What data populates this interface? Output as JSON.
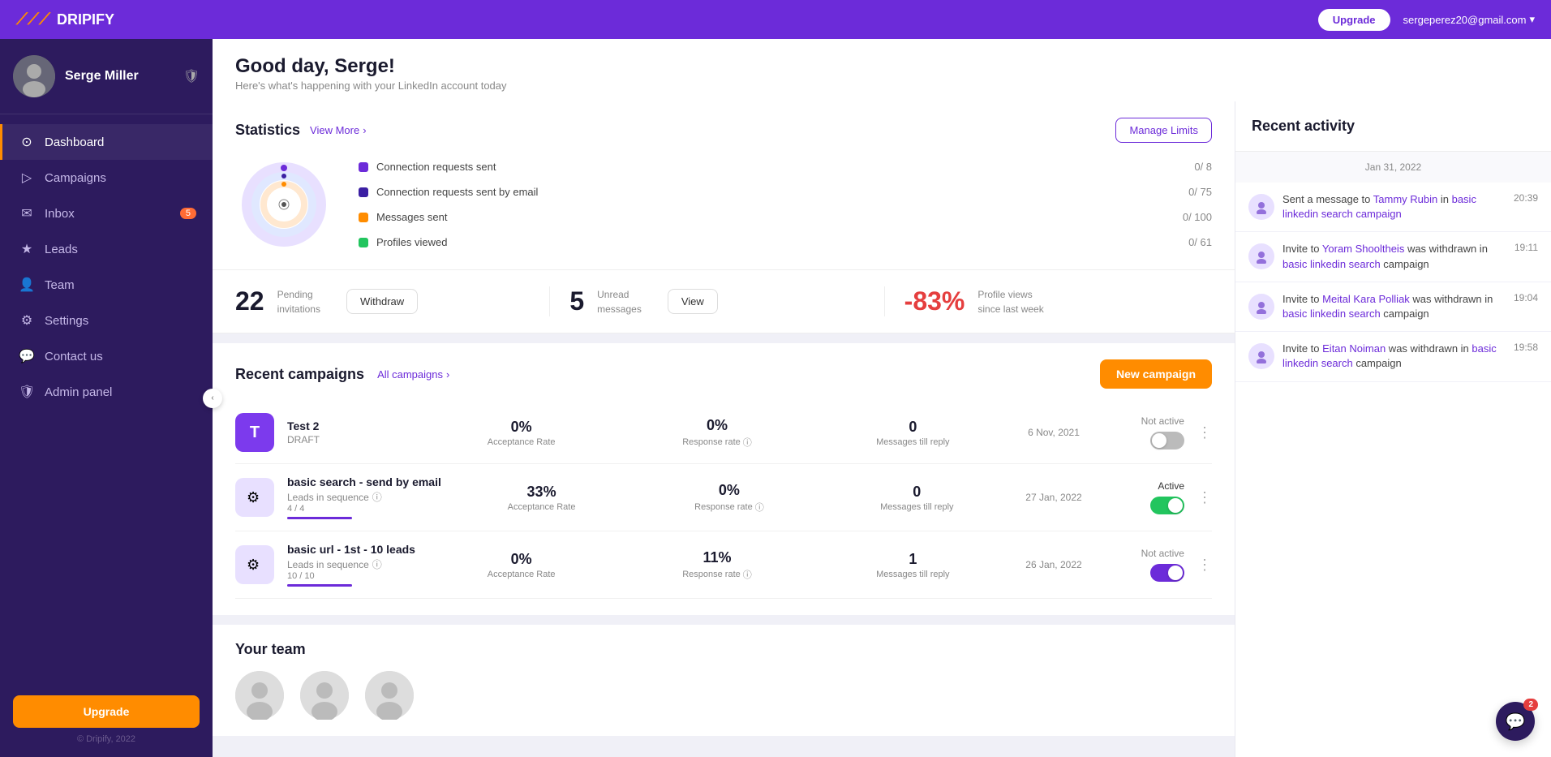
{
  "topbar": {
    "logo_text": "DRIPIFY",
    "upgrade_btn": "Upgrade",
    "user_email": "sergeperez20@gmail.com"
  },
  "sidebar": {
    "user_name": "Serge Miller",
    "nav_items": [
      {
        "id": "dashboard",
        "label": "Dashboard",
        "icon": "⊙",
        "active": true
      },
      {
        "id": "campaigns",
        "label": "Campaigns",
        "icon": "▷",
        "active": false
      },
      {
        "id": "inbox",
        "label": "Inbox",
        "icon": "✉",
        "badge": "5",
        "active": false
      },
      {
        "id": "leads",
        "label": "Leads",
        "icon": "★",
        "active": false
      },
      {
        "id": "team",
        "label": "Team",
        "icon": "👤",
        "active": false
      },
      {
        "id": "settings",
        "label": "Settings",
        "icon": "⚙",
        "active": false
      },
      {
        "id": "contact",
        "label": "Contact us",
        "icon": "💬",
        "active": false
      },
      {
        "id": "admin",
        "label": "Admin panel",
        "icon": "🛡",
        "active": false
      }
    ],
    "upgrade_btn": "Upgrade",
    "copyright": "© Dripify, 2022"
  },
  "header": {
    "greeting": "Good day, Serge!",
    "subtitle": "Here's what's happening with your LinkedIn account today"
  },
  "statistics": {
    "title": "Statistics",
    "view_more": "View More",
    "manage_limits": "Manage Limits",
    "items": [
      {
        "label": "Connection requests sent",
        "value": "0/ 8",
        "color": "#6c2bd9"
      },
      {
        "label": "Connection requests sent by email",
        "value": "0/ 75",
        "color": "#3b1fa3"
      },
      {
        "label": "Messages sent",
        "value": "0/ 100",
        "color": "#ff8c00"
      },
      {
        "label": "Profiles viewed",
        "value": "0/ 61",
        "color": "#22c55e"
      }
    ]
  },
  "metrics": [
    {
      "number": "22",
      "label": "Pending\ninvitations",
      "btn": "Withdraw"
    },
    {
      "number": "5",
      "label": "Unread\nmessages",
      "btn": "View"
    },
    {
      "number": "-83%",
      "label": "Profile views\nsince last week",
      "btn": null,
      "negative": true
    }
  ],
  "campaigns": {
    "title": "Recent campaigns",
    "all_label": "All campaigns",
    "new_btn": "New campaign",
    "items": [
      {
        "id": "test2",
        "icon_type": "draft",
        "icon_text": "T",
        "name": "Test 2",
        "status_tag": "DRAFT",
        "acceptance": "0%",
        "response": "0%",
        "messages": "0",
        "date": "6 Nov, 2021",
        "status": "Not active",
        "toggle": "off",
        "progress_pct": 0,
        "leads_label": null
      },
      {
        "id": "basic-email",
        "icon_type": "gear",
        "name": "basic search - send by email",
        "status_tag": "Leads in sequence",
        "leads_count": "4 / 4",
        "acceptance": "33%",
        "response": "0%",
        "messages": "0",
        "date": "27 Jan, 2022",
        "status": "Active",
        "toggle": "on",
        "progress_pct": 100
      },
      {
        "id": "basic-url",
        "icon_type": "gear",
        "name": "basic url - 1st - 10 leads",
        "status_tag": "Leads in sequence",
        "leads_count": "10 / 10",
        "acceptance": "0%",
        "response": "11%",
        "messages": "1",
        "date": "26 Jan, 2022",
        "status": "Not active",
        "toggle": "purple",
        "progress_pct": 100
      }
    ]
  },
  "team": {
    "title": "Your team"
  },
  "recent_activity": {
    "title": "Recent activity",
    "date_label": "Jan 31, 2022",
    "items": [
      {
        "text_before": "Sent a message to ",
        "link1": "Tammy Rubin",
        "text_mid": " in ",
        "link2": "basic linkedin search campaign",
        "time": "20:39"
      },
      {
        "text_before": "Invite to ",
        "link1": "Yoram Shooltheis",
        "text_mid": " was withdrawn in ",
        "link2": "basic linkedin search",
        "text_after": " campaign",
        "time": "19:11"
      },
      {
        "text_before": "Invite to ",
        "link1": "Meital Kara Polliak",
        "text_mid": " was withdrawn in ",
        "link2": "basic linkedin search",
        "text_after": " campaign",
        "time": "19:04"
      },
      {
        "text_before": "Invite to ",
        "link1": "Eitan Noiman",
        "text_mid": " was withdrawn in ",
        "link2": "basic linkedin search",
        "text_after": " campaign",
        "time": "19:58"
      }
    ]
  },
  "chat": {
    "badge": "2"
  }
}
